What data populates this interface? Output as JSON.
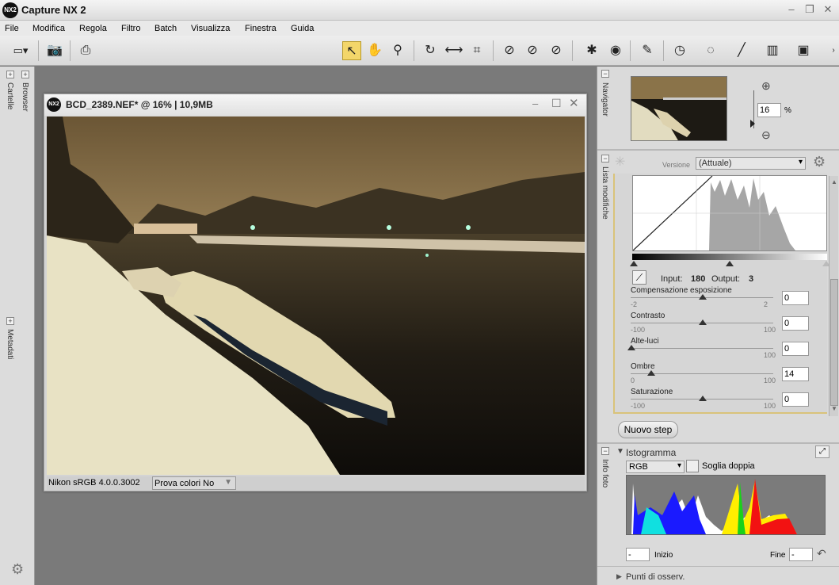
{
  "app": {
    "title": "Capture NX 2",
    "logo": "NX2"
  },
  "menu": [
    "File",
    "Modifica",
    "Regola",
    "Filtro",
    "Batch",
    "Visualizza",
    "Finestra",
    "Guida"
  ],
  "side_tabs": {
    "cartelle": "Cartelle",
    "browser": "Browser",
    "metadati": "Metadati"
  },
  "image_window": {
    "logo": "NX2",
    "title": "BCD_2389.NEF* @ 16% | 10,9MB",
    "profile": "Nikon sRGB 4.0.0.3002",
    "soft_proof": "Prova colori No"
  },
  "navigator": {
    "tab": "Navigator",
    "zoom": "16",
    "unit": "%"
  },
  "edit_list": {
    "tab": "Lista modifiche",
    "version_label": "Versione",
    "version_value": "(Attuale)",
    "input_label": "Input:",
    "input_value": "180",
    "output_label": "Output:",
    "output_value": "3",
    "sliders": [
      {
        "label": "Compensazione esposizione",
        "min": "-2",
        "max": "2",
        "value": "0",
        "pos": 0.5
      },
      {
        "label": "Contrasto",
        "min": "-100",
        "max": "100",
        "value": "0",
        "pos": 0.5
      },
      {
        "label": "Alte-luci",
        "min": "",
        "max": "100",
        "value": "0",
        "pos": 0
      },
      {
        "label": "Ombre",
        "min": "0",
        "max": "100",
        "value": "14",
        "pos": 0.14
      },
      {
        "label": "Saturazione",
        "min": "-100",
        "max": "100",
        "value": "0",
        "pos": 0.5
      }
    ],
    "new_step": "Nuovo step"
  },
  "info": {
    "tab": "Info foto",
    "histogram_title": "Istogramma",
    "channel": "RGB",
    "dual_threshold": "Soglia doppia",
    "start_label": "Inizio",
    "start_value": "-",
    "end_label": "Fine",
    "end_value": "-",
    "watch_points": "Punti di osserv."
  }
}
